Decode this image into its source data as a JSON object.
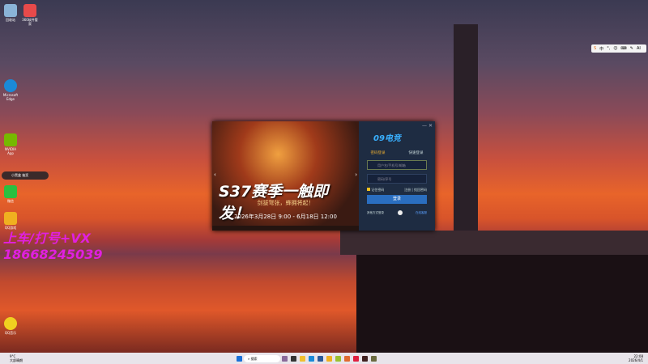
{
  "desktop_icons": [
    {
      "label": "回收站",
      "color": "#8ab4d8"
    },
    {
      "label": "360软件管家",
      "color": "#e84a4a"
    },
    {
      "label": "Microsoft Edge",
      "color": "#1a8ad8"
    },
    {
      "label": "NVIDIA App",
      "color": "#76b900"
    },
    {
      "label": "微信",
      "color": "#2ac040"
    },
    {
      "label": "QQ游戏",
      "color": "#f0b020"
    },
    {
      "label": "QQ音乐",
      "color": "#f0d020"
    }
  ],
  "notification": "小黑盒 抽奖",
  "watermark": {
    "line1": "上车/打号+VX",
    "line2": "18668245039"
  },
  "dialog": {
    "banner": {
      "title": "S37赛季一触即发！",
      "subtitle": "剑拔弩张，蜂拥将起！",
      "date": "2026年3月28日 9:00 - 6月18日 12:00"
    },
    "logo": "09电竞",
    "tabs": [
      "密码登录",
      "快速登录"
    ],
    "username_placeholder": "用户名/手机号/邮箱",
    "password_placeholder": "密码/序号",
    "remember": "记住密码",
    "register": "注册",
    "forgot": "找回密码",
    "login_button": "登录",
    "other_login": "其他方式登录",
    "support": "在线客服"
  },
  "ime": [
    "S",
    "中",
    "°,",
    "☺",
    "⌨",
    "✎",
    "AI"
  ],
  "taskbar": {
    "weather_temp": "9°C",
    "weather_desc": "大部晴朗",
    "search": "搜索",
    "time": "22:08",
    "date": "2026/4/1"
  }
}
